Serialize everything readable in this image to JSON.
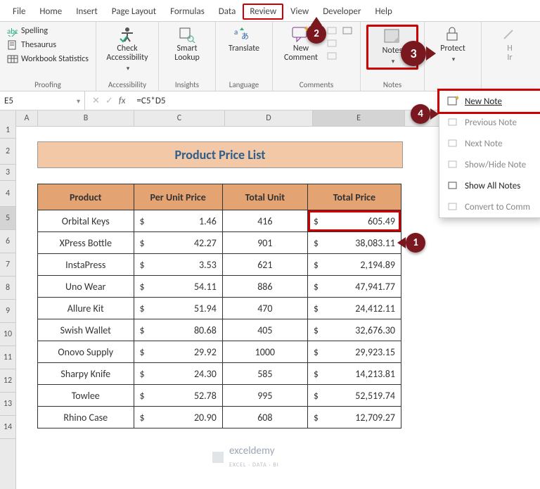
{
  "tabs": [
    "File",
    "Home",
    "Insert",
    "Page Layout",
    "Formulas",
    "Data",
    "Review",
    "View",
    "Developer",
    "Help"
  ],
  "active_tab": "Review",
  "ribbon": {
    "proofing": {
      "label": "Proofing",
      "spelling": "Spelling",
      "thesaurus": "Thesaurus",
      "stats": "Workbook Statistics"
    },
    "accessibility": {
      "label": "Accessibility",
      "check": "Check\nAccessibility"
    },
    "insights": {
      "label": "Insights",
      "smart": "Smart\nLookup"
    },
    "language": {
      "label": "Language",
      "translate": "Translate"
    },
    "comments": {
      "label": "Comments",
      "new": "New\nComment"
    },
    "notes": {
      "label": "Notes",
      "btn": "Notes"
    },
    "protect": {
      "label": "Protect",
      "btn": "Protect"
    }
  },
  "notes_menu": {
    "new": "New Note",
    "prev": "Previous Note",
    "next": "Next Note",
    "showhide": "Show/Hide Note",
    "showall": "Show All Notes",
    "convert": "Convert to Comm"
  },
  "formula": {
    "cell": "E5",
    "fx": "fx",
    "value": "=C5*D5"
  },
  "sheet": {
    "title": "Product Price List",
    "headers": [
      "Product",
      "Per Unit Price",
      "Total Unit",
      "Total Price"
    ],
    "rows": [
      {
        "p": "Orbital Keys",
        "u": "1.46",
        "t": "416",
        "tp": "605.49"
      },
      {
        "p": "XPress Bottle",
        "u": "42.27",
        "t": "901",
        "tp": "38,083.11"
      },
      {
        "p": "InstaPress",
        "u": "3.53",
        "t": "621",
        "tp": "2,194.89"
      },
      {
        "p": "Uno Wear",
        "u": "54.11",
        "t": "886",
        "tp": "47,941.77"
      },
      {
        "p": "Allure Kit",
        "u": "51.94",
        "t": "470",
        "tp": "24,412.11"
      },
      {
        "p": "Swish Wallet",
        "u": "80.68",
        "t": "405",
        "tp": "32,676.30"
      },
      {
        "p": "Onovo Supply",
        "u": "29.92",
        "t": "1000",
        "tp": "29,923.15"
      },
      {
        "p": "Sharpy Knife",
        "u": "24.30",
        "t": "585",
        "tp": "14,213.81"
      },
      {
        "p": "Towlee",
        "u": "52.78",
        "t": "995",
        "tp": "52,519.74"
      },
      {
        "p": "Rhino Case",
        "u": "20.90",
        "t": "608",
        "tp": "12,709.27"
      }
    ]
  },
  "cols": [
    "A",
    "B",
    "C",
    "D",
    "E"
  ],
  "rownums": [
    "1",
    "2",
    "3",
    "4",
    "5",
    "6",
    "7",
    "8",
    "9",
    "10",
    "11",
    "12",
    "13",
    "14"
  ],
  "callouts": {
    "1": "1",
    "2": "2",
    "3": "3",
    "4": "4"
  },
  "watermark": {
    "brand": "exceldemy",
    "sub": "EXCEL · DATA · BI"
  }
}
